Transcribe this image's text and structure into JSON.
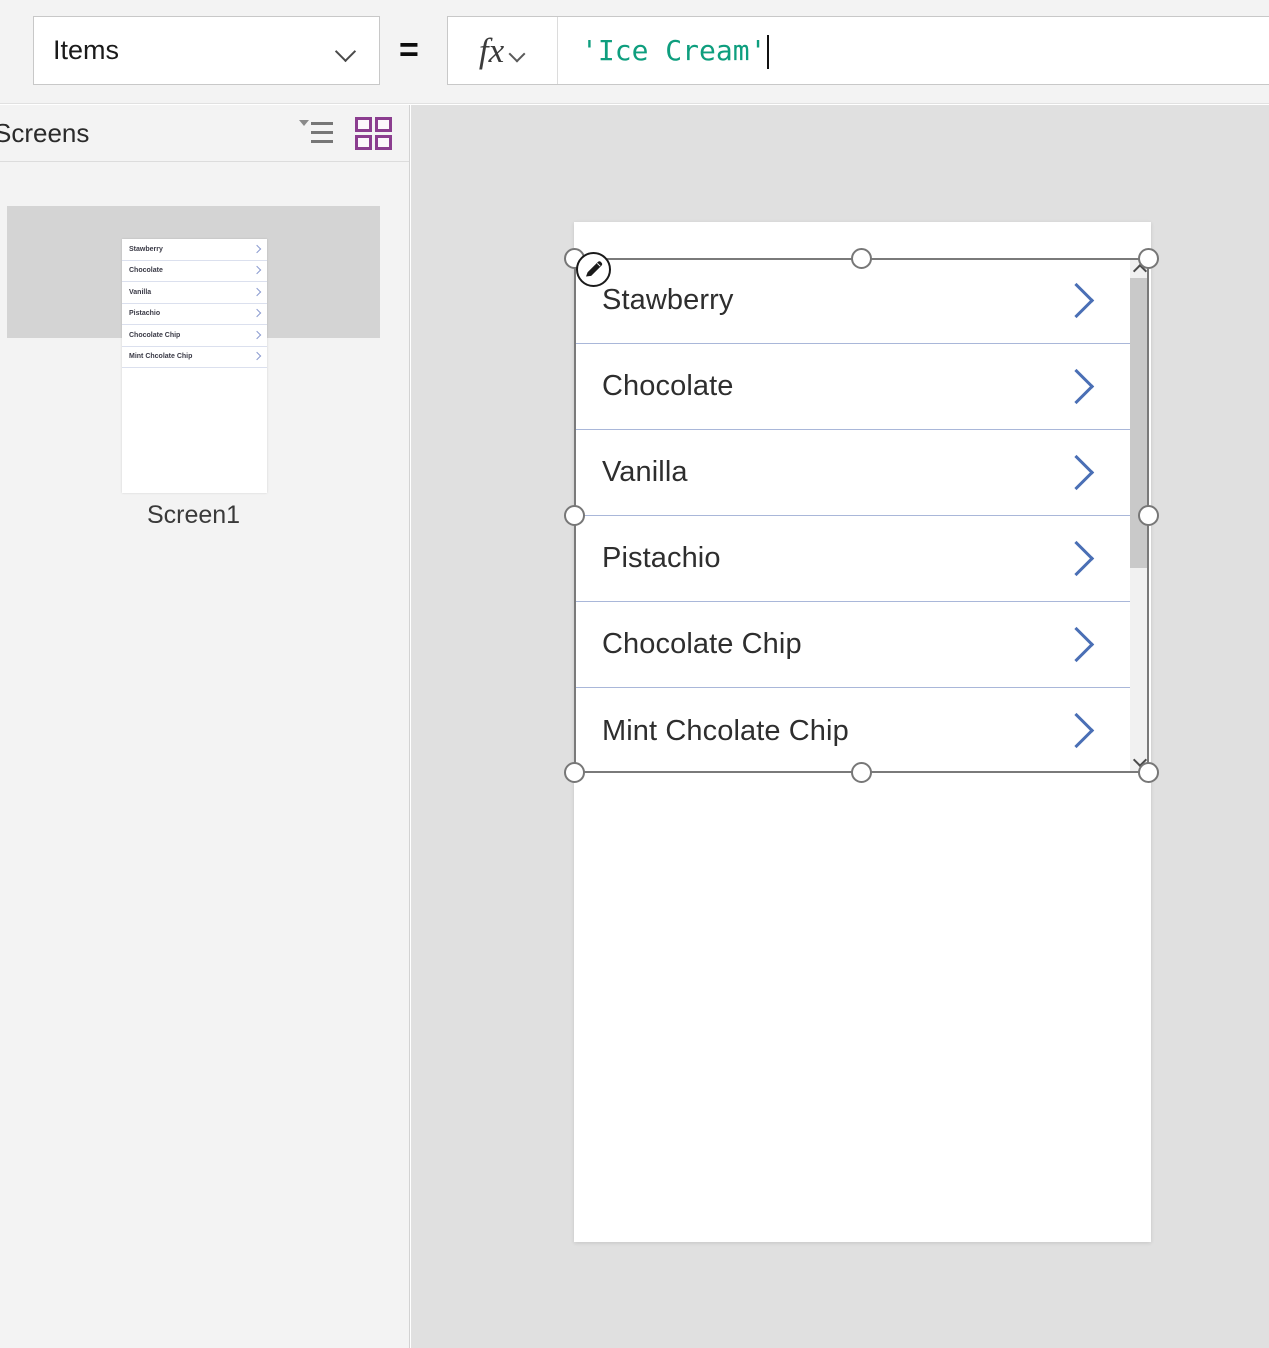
{
  "formula_bar": {
    "property_name": "Items",
    "equals": "=",
    "fx_label": "fx",
    "formula_value": "'Ice Cream'",
    "dropdown_icon": "chevron-down-icon",
    "fx_dropdown_icon": "chevron-down-icon"
  },
  "left_panel": {
    "header_title": "Screens",
    "tree_view_icon": "tree-list-icon",
    "thumbnail_view_icon": "grid-view-icon",
    "accent_color": "#8b3d8f",
    "screens": [
      {
        "name": "Screen1",
        "selected": true,
        "thumb_items": [
          "Stawberry",
          "Chocolate",
          "Vanilla",
          "Pistachio",
          "Chocolate Chip",
          "Mint Chcolate Chip"
        ]
      }
    ]
  },
  "canvas": {
    "background_color": "#e0e0e0",
    "screen_background": "#ffffff",
    "gallery": {
      "selected": true,
      "edit_badge_icon": "pencil-icon",
      "chevron_icon": "chevron-right-icon",
      "chevron_color": "#4a6fb5",
      "separator_color": "#a9b7d9",
      "items": [
        "Stawberry",
        "Chocolate",
        "Vanilla",
        "Pistachio",
        "Chocolate Chip",
        "Mint Chcolate Chip"
      ],
      "scrollbar": {
        "up_icon": "chevron-up-icon",
        "down_icon": "chevron-down-icon",
        "thumb_color": "#c9c9c9",
        "track_color": "#f1f1f1"
      }
    }
  }
}
